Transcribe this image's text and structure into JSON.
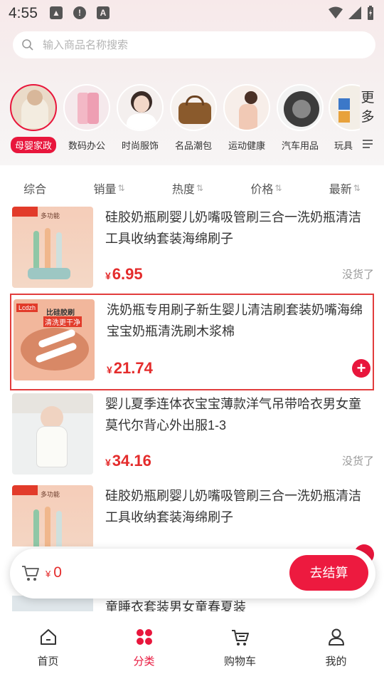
{
  "status": {
    "time": "4:55"
  },
  "search": {
    "placeholder": "输入商品名称搜索"
  },
  "categories": [
    {
      "label": "母婴家政",
      "active": true
    },
    {
      "label": "数码办公",
      "active": false
    },
    {
      "label": "时尚服饰",
      "active": false
    },
    {
      "label": "名品潮包",
      "active": false
    },
    {
      "label": "运动健康",
      "active": false
    },
    {
      "label": "汽车用品",
      "active": false
    },
    {
      "label": "玩具",
      "active": false
    }
  ],
  "more_label": "更多",
  "sort": [
    {
      "label": "综合",
      "arrow": ""
    },
    {
      "label": "销量",
      "arrow": "⇅"
    },
    {
      "label": "热度",
      "arrow": "⇅"
    },
    {
      "label": "价格",
      "arrow": "⇅"
    },
    {
      "label": "最新",
      "arrow": "⇅"
    }
  ],
  "products": [
    {
      "title": "硅胶奶瓶刷婴儿奶嘴吸管刷三合一洗奶瓶清洁工具收纳套装海绵刷子",
      "currency": "¥",
      "price": "6.95",
      "stock": "没货了"
    },
    {
      "title": "洗奶瓶专用刷子新生婴儿清洁刷套装奶嘴海绵宝宝奶瓶清洗刷木浆棉",
      "currency": "¥",
      "price": "21.74",
      "stock": ""
    },
    {
      "title": "婴儿夏季连体衣宝宝薄款洋气吊带哈衣男女童莫代尔背心外出服1-3",
      "currency": "¥",
      "price": "34.16",
      "stock": "没货了"
    },
    {
      "title": "硅胶奶瓶刷婴儿奶嘴吸管刷三合一洗奶瓶清洁工具收纳套装海绵刷子",
      "currency": "¥",
      "price": "",
      "stock": ""
    }
  ],
  "thumb_text": {
    "p1_badge": "多功能",
    "p2_brand": "Lcdzh",
    "p2_line1": "比硅胶刷",
    "p2_line2": "清洗更干净"
  },
  "hidden_line": "童睡衣套装男女童春夏装",
  "cart": {
    "currency": "¥",
    "total": "0",
    "checkout": "去结算"
  },
  "nav": [
    {
      "label": "首页"
    },
    {
      "label": "分类"
    },
    {
      "label": "购物车"
    },
    {
      "label": "我的"
    }
  ],
  "colors": {
    "accent": "#e8163c",
    "price": "#e42c2c"
  }
}
